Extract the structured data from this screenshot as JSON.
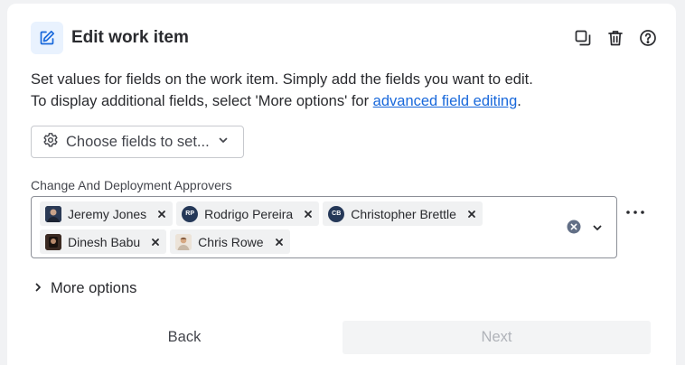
{
  "header": {
    "title": "Edit work item"
  },
  "description": {
    "line1": "Set values for fields on the work item. Simply add the fields you want to edit.",
    "line2_prefix": "To display additional fields, select 'More options' for ",
    "link_text": "advanced field editing",
    "line2_suffix": "."
  },
  "choose_fields": {
    "label": "Choose fields to set..."
  },
  "field": {
    "label": "Change And Deployment Approvers",
    "chips": [
      {
        "name": "Jeremy Jones",
        "initials": "",
        "avatar_color": "#2b3a55"
      },
      {
        "name": "Rodrigo Pereira",
        "initials": "RP",
        "avatar_color": "#253858"
      },
      {
        "name": "Christopher Brettle",
        "initials": "CB",
        "avatar_color": "#253858"
      },
      {
        "name": "Dinesh Babu",
        "initials": "",
        "avatar_color": "#3b2a22"
      },
      {
        "name": "Chris Rowe",
        "initials": "",
        "avatar_color": "#d9c7b3"
      }
    ]
  },
  "more_options": {
    "label": "More options"
  },
  "footer": {
    "back_label": "Back",
    "next_label": "Next"
  },
  "colors": {
    "accent": "#1868db",
    "icon_bg": "#e9f2fe"
  }
}
